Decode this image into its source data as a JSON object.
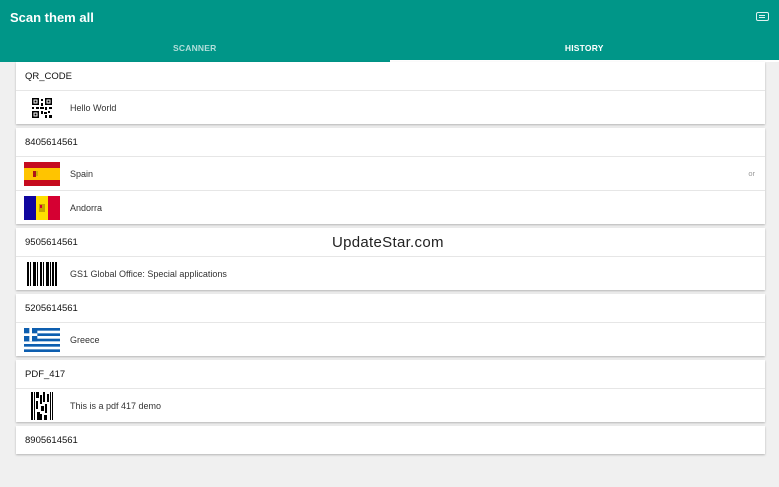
{
  "app": {
    "title": "Scan them all",
    "keyboard_icon": "keyboard-icon"
  },
  "tabs": [
    {
      "label": "SCANNER",
      "active": false
    },
    {
      "label": "HISTORY",
      "active": true
    }
  ],
  "history": [
    {
      "code": "QR_CODE",
      "items": [
        {
          "icon": "qr-code-icon",
          "label": "Hello World"
        }
      ]
    },
    {
      "code": "8405614561",
      "items": [
        {
          "icon": "spain-flag-icon",
          "label": "Spain",
          "note": "or"
        },
        {
          "icon": "andorra-flag-icon",
          "label": "Andorra"
        }
      ]
    },
    {
      "code": "9505614561",
      "items": [
        {
          "icon": "barcode-icon",
          "label": "GS1 Global Office: Special applications"
        }
      ]
    },
    {
      "code": "5205614561",
      "items": [
        {
          "icon": "greece-flag-icon",
          "label": "Greece"
        }
      ]
    },
    {
      "code": "PDF_417",
      "items": [
        {
          "icon": "pdf417-icon",
          "label": "This is a pdf 417 demo"
        }
      ]
    },
    {
      "code": "8905614561",
      "items": []
    }
  ],
  "watermark": "UpdateStar.com",
  "colors": {
    "appbar": "#009688",
    "background": "#f0f0f0"
  }
}
